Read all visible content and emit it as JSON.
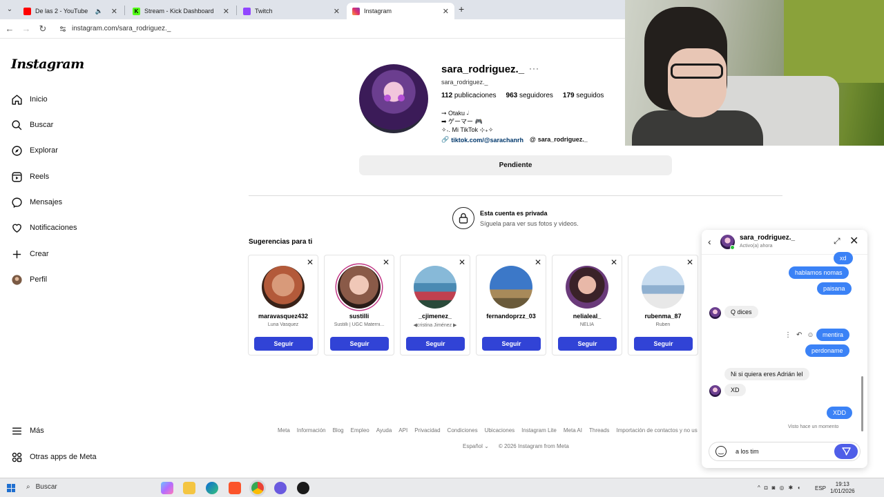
{
  "browser": {
    "tabs": [
      {
        "title": "De las 2 - YouTube",
        "favicon_color": "#ff0000",
        "muted": true
      },
      {
        "title": "Stream - Kick Dashboard",
        "favicon_color": "#53fc18"
      },
      {
        "title": "Twitch",
        "favicon_color": "#9146ff"
      },
      {
        "title": "Instagram",
        "favicon_color": "#e1306c",
        "active": true
      }
    ],
    "url": "instagram.com/sara_rodriguez._"
  },
  "nav": {
    "logo": "Instagram",
    "items": [
      {
        "label": "Inicio",
        "icon": "home-icon"
      },
      {
        "label": "Buscar",
        "icon": "search-icon"
      },
      {
        "label": "Explorar",
        "icon": "compass-icon"
      },
      {
        "label": "Reels",
        "icon": "reels-icon"
      },
      {
        "label": "Mensajes",
        "icon": "messenger-icon"
      },
      {
        "label": "Notificaciones",
        "icon": "heart-icon"
      },
      {
        "label": "Crear",
        "icon": "plus-icon"
      },
      {
        "label": "Perfil",
        "icon": "avatar"
      },
      {
        "label": "Más",
        "icon": "menu-icon"
      },
      {
        "label": "Otras apps de Meta",
        "icon": "meta-apps-icon"
      }
    ]
  },
  "profile": {
    "username": "sara_rodriguez._",
    "full_name": "sara_rodriguez._",
    "posts": "112",
    "posts_label": "publicaciones",
    "followers": "963",
    "followers_label": "seguidores",
    "following": "179",
    "following_label": "seguidos",
    "bio_lines": [
      "➞ Otaku 𝆺𝅥",
      "➡ ゲーマー 🎮",
      "✧˖. Mi TikTok ⊹₊✧"
    ],
    "link": "tiktok.com/@sarachanrh",
    "threads": "sara_rodriguez._",
    "pending_label": "Pendiente",
    "private_title": "Esta cuenta es privada",
    "private_sub": "Síguela para ver sus fotos y videos."
  },
  "suggestions": {
    "title": "Sugerencias para ti",
    "button_label": "Seguir",
    "cards": [
      {
        "name": "maravasquez432",
        "sub": "Luna Vasquez",
        "color": "#b35a3a"
      },
      {
        "name": "sustilli",
        "sub": "Sustilli | UGC Materni...",
        "color": "#8a5a48"
      },
      {
        "name": "_cjimenez_",
        "sub": "◀cristina Jiménez ▶",
        "color": "#4a8ab3"
      },
      {
        "name": "fernandoprzz_03",
        "sub": "",
        "color": "#3c78c8"
      },
      {
        "name": "nelialeal_",
        "sub": "NELIA",
        "color": "#6a3a7a"
      },
      {
        "name": "rubenma_87",
        "sub": "Ruben",
        "color": "#8fb0d0"
      }
    ]
  },
  "footer": {
    "links": [
      "Meta",
      "Información",
      "Blog",
      "Empleo",
      "Ayuda",
      "API",
      "Privacidad",
      "Condiciones",
      "Ubicaciones",
      "Instagram Lite",
      "Meta AI",
      "Threads",
      "Importación de contactos y no us"
    ],
    "language": "Español ⌄",
    "copyright": "© 2026 Instagram from Meta"
  },
  "chat": {
    "name": "sara_rodriguez._",
    "status": "Activo(a) ahora",
    "messages": [
      {
        "text": "xd",
        "dir": "out"
      },
      {
        "text": "hablamos nomas",
        "dir": "out"
      },
      {
        "text": "paisana",
        "dir": "out"
      },
      {
        "text": "Q dices",
        "dir": "in"
      },
      {
        "text": "mentira",
        "dir": "out"
      },
      {
        "text": "perdoname",
        "dir": "out"
      },
      {
        "text": "Ni si quiera eres Adrián lel",
        "dir": "in"
      },
      {
        "text": "XD",
        "dir": "in"
      },
      {
        "text": "XDD",
        "dir": "out"
      }
    ],
    "seen": "Visto hace un momento",
    "input_value": "a los tim"
  },
  "taskbar": {
    "search_label": "Buscar",
    "lang": "ESP",
    "time": "19:13",
    "date": "1/01/2026"
  }
}
